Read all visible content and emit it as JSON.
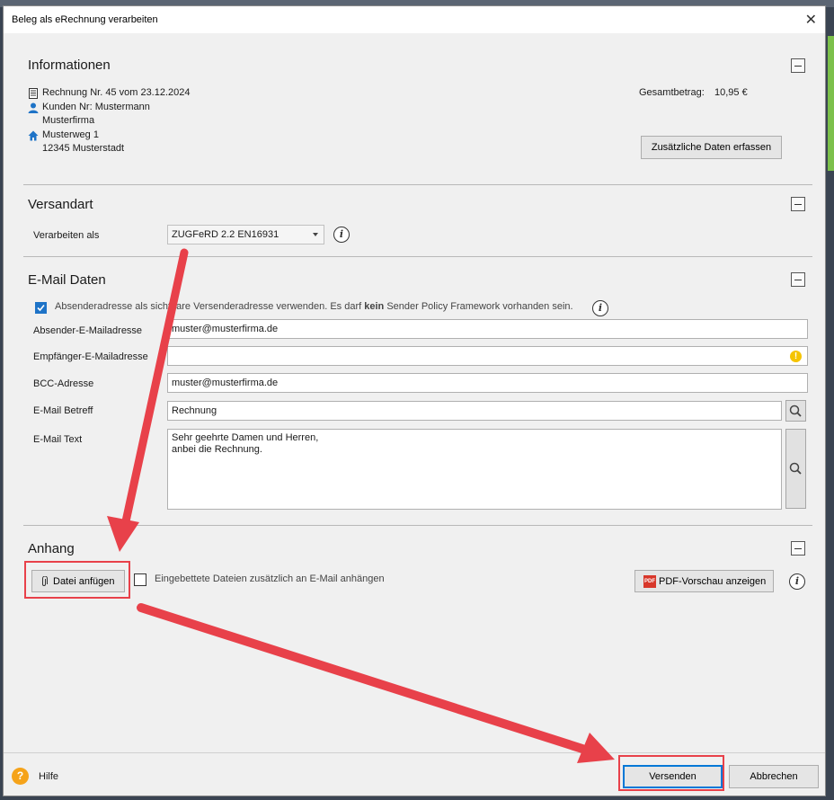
{
  "window": {
    "title": "Beleg als eRechnung verarbeiten",
    "close_glyph": "✕"
  },
  "info": {
    "title": "Informationen",
    "invoice": "Rechnung Nr. 45 vom 23.12.2024",
    "customer": "Kunden Nr: Mustermann",
    "company": "Musterfirma",
    "street": "Musterweg 1",
    "city": "12345 Musterstadt",
    "total_label": "Gesamtbetrag:",
    "total_value": "10,95 €",
    "extra_button": "Zusätzliche Daten erfassen"
  },
  "versand": {
    "title": "Versandart",
    "label": "Verarbeiten als",
    "selected": "ZUGFeRD 2.2 EN16931",
    "info_glyph": "i"
  },
  "email": {
    "title": "E-Mail Daten",
    "checkbox_text_pre": "Absenderadresse als sichtbare Versenderadresse verwenden. Es darf ",
    "checkbox_text_bold": "kein",
    "checkbox_text_post": " Sender Policy Framework vorhanden sein.",
    "checkbox_checked": true,
    "info_glyph": "i",
    "sender_label": "Absender-E-Mailadresse",
    "sender_value": "muster@musterfirma.de",
    "recipient_label": "Empfänger-E-Mailadresse",
    "recipient_value": "",
    "warning_glyph": "!",
    "bcc_label": "BCC-Adresse",
    "bcc_value": "muster@musterfirma.de",
    "subject_label": "E-Mail Betreff",
    "subject_value": "Rechnung",
    "body_label": "E-Mail Text",
    "body_value": "Sehr geehrte Damen und Herren,\nanbei die Rechnung."
  },
  "anhang": {
    "title": "Anhang",
    "attach_button": "Datei anfügen",
    "embed_checkbox_label": "Eingebettete Dateien zusätzlich an E-Mail anhängen",
    "embed_checked": false,
    "pdf_button": "PDF-Vorschau anzeigen",
    "pdf_icon_text": "PDF",
    "info_glyph": "i"
  },
  "footer": {
    "help_label": "Hilfe",
    "help_glyph": "?",
    "send_button": "Versenden",
    "cancel_button": "Abbrechen"
  },
  "colors": {
    "accent_blue": "#1e73c7",
    "highlight_red": "#e8414a",
    "warning_yellow": "#f5c400",
    "help_orange": "#f5a31a"
  }
}
